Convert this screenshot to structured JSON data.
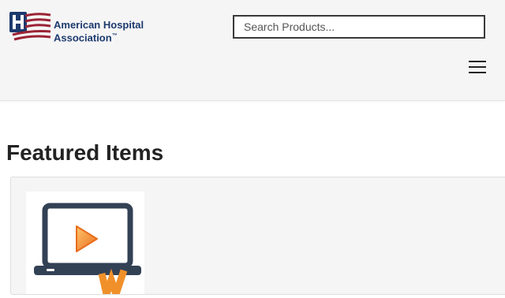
{
  "header": {
    "logo": {
      "line1": "American Hospital",
      "line2": "Association",
      "trademark": "™",
      "icon": "aha-logo-icon"
    },
    "search": {
      "placeholder": "Search Products...",
      "value": ""
    },
    "menu_icon": "hamburger-menu-icon"
  },
  "main": {
    "section_title": "Featured Items",
    "items": [
      {
        "thumbnail_icon": "laptop-video-play-icon"
      }
    ]
  },
  "colors": {
    "header_bg": "#f5f5f5",
    "logo_navy": "#1d3a6e",
    "logo_red": "#9b2335",
    "laptop_dark": "#334155",
    "play_orange": "#f0902a"
  }
}
